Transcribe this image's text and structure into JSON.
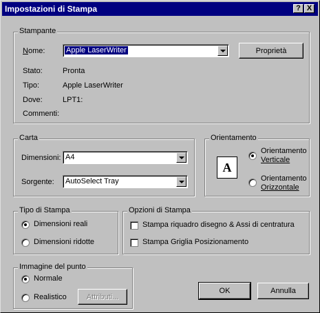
{
  "window": {
    "title": "Impostazioni di Stampa",
    "help_label": "?",
    "close_label": "X"
  },
  "printer": {
    "group_label": "Stampante",
    "name_label": "Nome:",
    "name_value": "Apple LaserWriter",
    "properties_label": "Proprietà",
    "status_label": "Stato:",
    "status_value": "Pronta",
    "type_label": "Tipo:",
    "type_value": "Apple LaserWriter",
    "where_label": "Dove:",
    "where_value": "LPT1:",
    "comments_label": "Commenti:"
  },
  "paper": {
    "group_label": "Carta",
    "size_label": "Dimensioni:",
    "size_value": "A4",
    "source_label": "Sorgente:",
    "source_value": "AutoSelect Tray"
  },
  "orientation": {
    "group_label": "Orientamento",
    "icon_letter": "A",
    "portrait_line1": "Orientamento",
    "portrait_line2": "Verticale",
    "landscape_line1": "Orientamento",
    "landscape_line2": "Orizzontale",
    "selected": "portrait"
  },
  "print_type": {
    "group_label": "Tipo di Stampa",
    "actual_size": "Dimensioni reali",
    "reduced_size": "Dimensioni ridotte",
    "selected": "actual_size"
  },
  "print_options": {
    "group_label": "Opzioni di Stampa",
    "option_border": "Stampa riquadro disegno & Assi di centratura",
    "option_grid": "Stampa Griglia Posizionamento"
  },
  "dot_image": {
    "group_label": "Immagine del punto",
    "normal": "Normale",
    "realistic": "Realistico",
    "attributes_button": "Attributi...",
    "selected": "normal"
  },
  "buttons": {
    "ok": "OK",
    "cancel": "Annulla"
  }
}
